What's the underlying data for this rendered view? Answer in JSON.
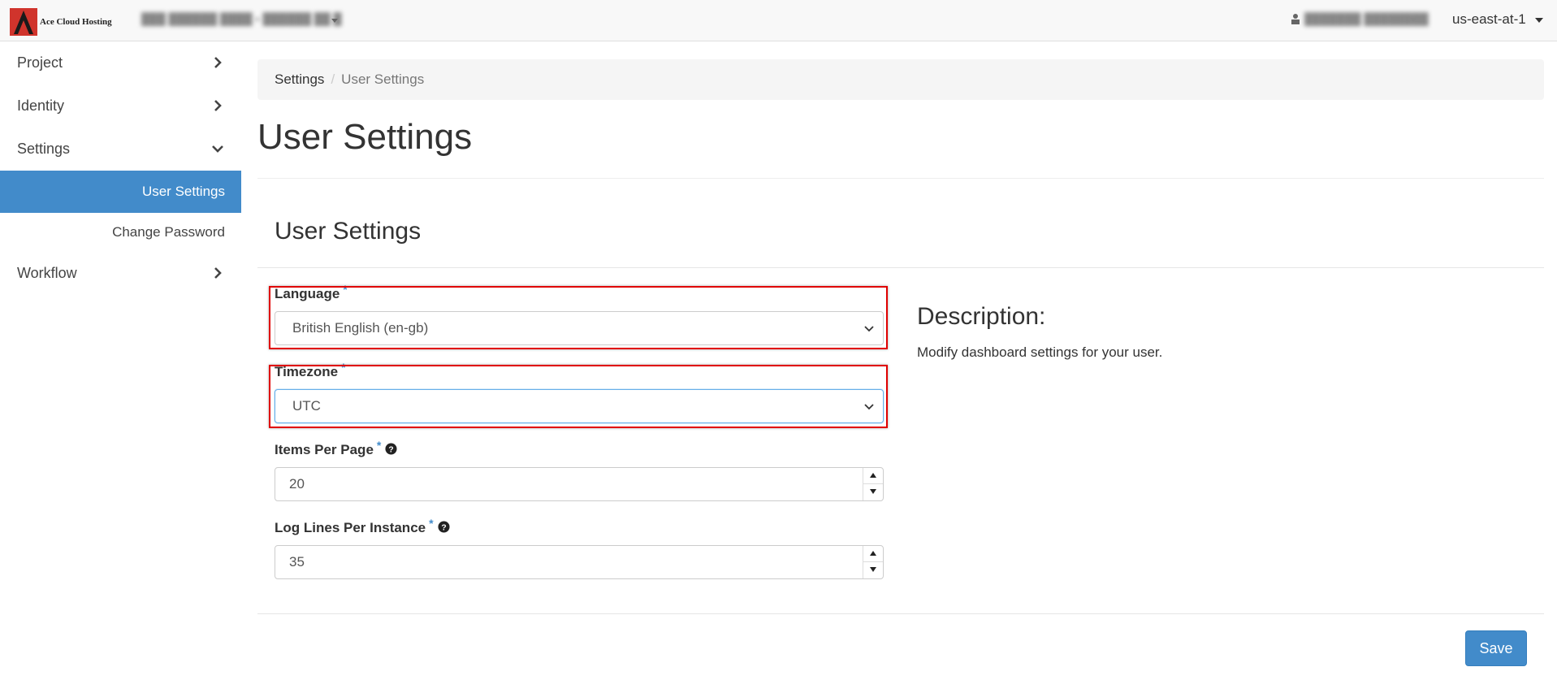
{
  "topbar": {
    "brand": "Ace Cloud Hosting",
    "project_selector": "███ ██████ ████ ▪ ██████ ██ █",
    "user_menu": "███████ ████████",
    "region": "us-east-at-1"
  },
  "sidebar": {
    "items": [
      {
        "label": "Project",
        "icon": "chevron-right-icon"
      },
      {
        "label": "Identity",
        "icon": "chevron-right-icon"
      },
      {
        "label": "Settings",
        "icon": "chevron-down-icon"
      },
      {
        "label": "Workflow",
        "icon": "chevron-right-icon"
      }
    ],
    "settings_sub": [
      {
        "label": "User Settings",
        "active": true
      },
      {
        "label": "Change Password",
        "active": false
      }
    ]
  },
  "breadcrumb": {
    "root": "Settings",
    "separator": "/",
    "current": "User Settings"
  },
  "page_title": "User Settings",
  "section_title": "User Settings",
  "form": {
    "language": {
      "label": "Language",
      "required_mark": "*",
      "value": "British English (en-gb)"
    },
    "timezone": {
      "label": "Timezone",
      "required_mark": "*",
      "value": "UTC"
    },
    "items_per_page": {
      "label": "Items Per Page",
      "required_mark": "*",
      "value": "20"
    },
    "log_lines": {
      "label": "Log Lines Per Instance",
      "required_mark": "*",
      "value": "35"
    }
  },
  "description": {
    "title": "Description:",
    "text": "Modify dashboard settings for your user."
  },
  "actions": {
    "save_label": "Save"
  },
  "colors": {
    "accent": "#428bca",
    "highlight": "#e00000",
    "brand_red": "#d0342c"
  }
}
